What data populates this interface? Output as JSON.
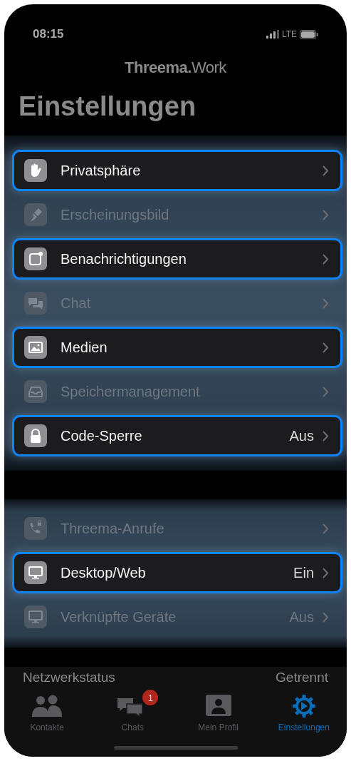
{
  "status_bar": {
    "time": "08:15",
    "network": "LTE"
  },
  "logo": "**Threema.**Work",
  "title": "Einstellungen",
  "groups": [
    {
      "rows": [
        {
          "label": "Privatsphäre",
          "highlighted": true
        },
        {
          "label": "Erscheinungsbild",
          "highlighted": false
        },
        {
          "label": "Benachrichtigungen",
          "highlighted": true
        },
        {
          "label": "Chat",
          "highlighted": false
        },
        {
          "label": "Medien",
          "highlighted": true
        },
        {
          "label": "Speichermanagement",
          "highlighted": false
        },
        {
          "label": "Code-Sperre",
          "value": "Aus",
          "highlighted": true
        }
      ]
    },
    {
      "rows": [
        {
          "label": "Threema-Anrufe",
          "highlighted": false
        },
        {
          "label": "Desktop/Web",
          "value": "Ein",
          "highlighted": true
        },
        {
          "label": "Verknüpfte Geräte",
          "value": "Aus",
          "highlighted": false
        }
      ]
    }
  ],
  "network_status": {
    "label": "Netzwerkstatus",
    "value": "Getrennt"
  },
  "tabs": [
    {
      "label": "Kontakte",
      "selected": false
    },
    {
      "label": "Chats",
      "selected": false,
      "badge": "1"
    },
    {
      "label": "Mein Profil",
      "selected": false
    },
    {
      "label": "Einstellungen",
      "selected": true
    }
  ]
}
